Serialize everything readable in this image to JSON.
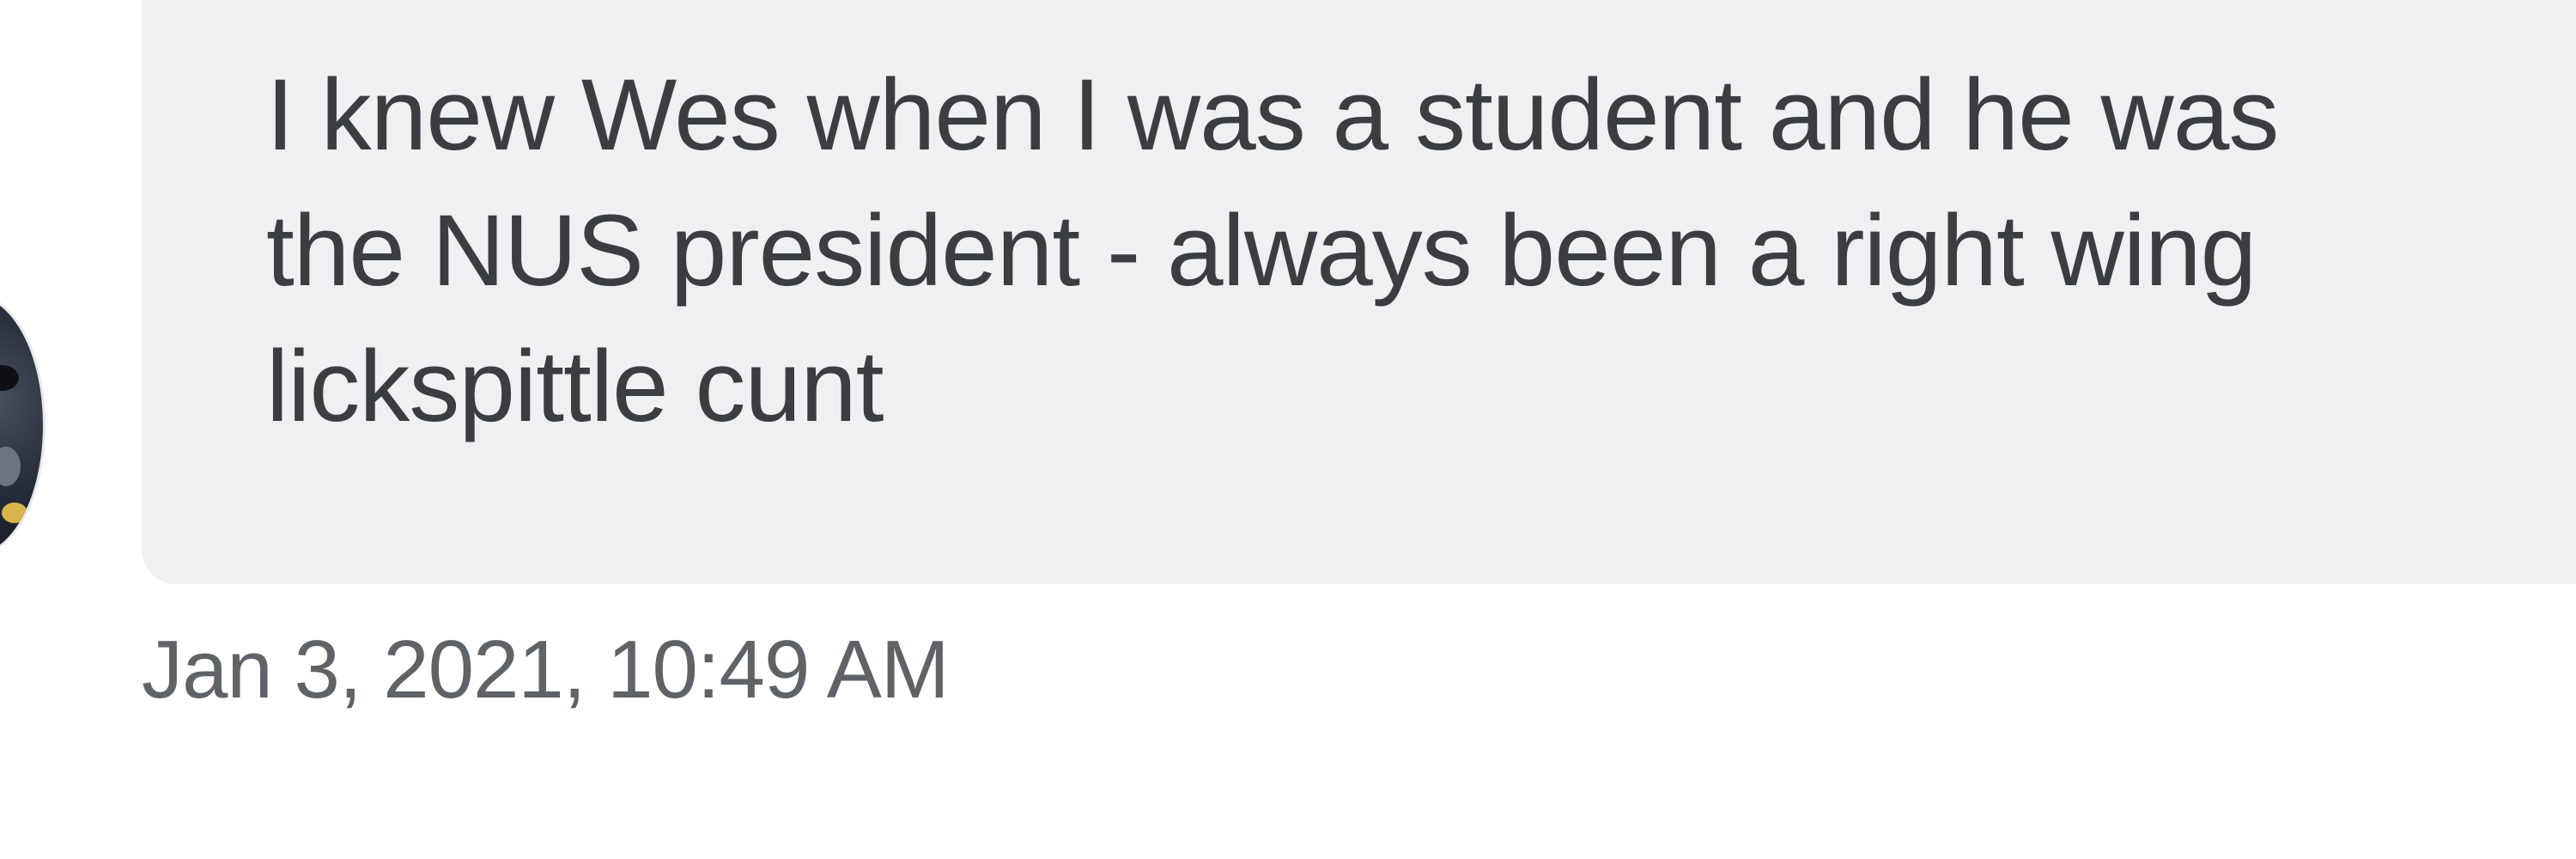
{
  "message": {
    "lines": [
      "I knew Wes when I was a student and he was",
      "the NUS president - always been a right wing",
      "lickspittle cunt"
    ]
  },
  "meta": {
    "timestamp": "Jan 3, 2021, 10:49 AM"
  },
  "colors": {
    "bubble_background": "#eef0f2",
    "message_text": "#3a3d42",
    "timestamp_text": "#5f6368"
  }
}
